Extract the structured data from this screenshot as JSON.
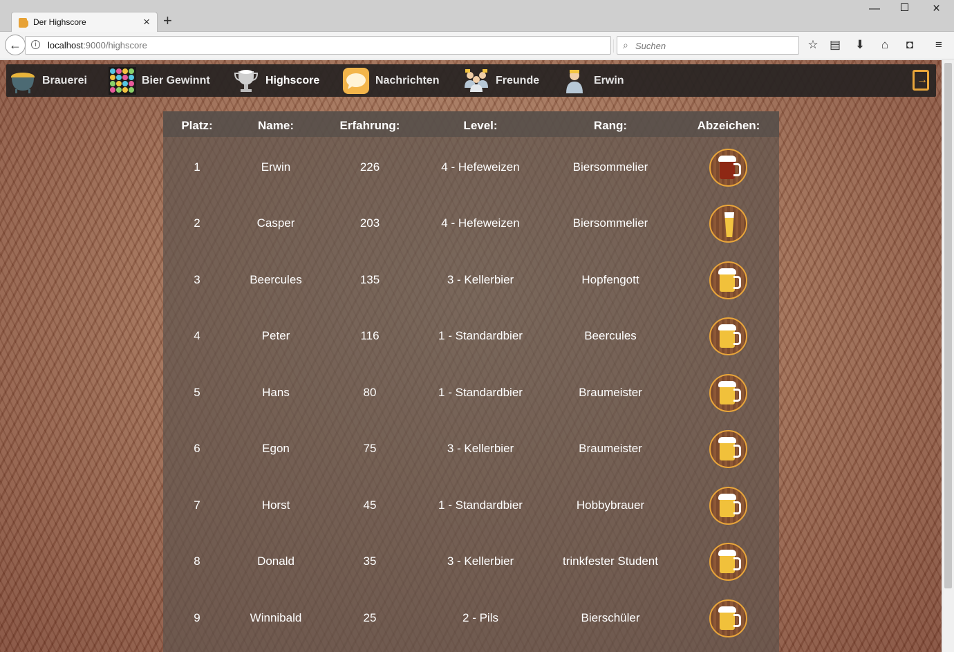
{
  "browser": {
    "tab_title": "Der Highscore",
    "url_host": "localhost",
    "url_path": ":9000/highscore",
    "search_placeholder": "Suchen"
  },
  "app_nav": {
    "items": [
      {
        "label": "Brauerei",
        "icon": "cauldron-icon"
      },
      {
        "label": "Bier Gewinnt",
        "icon": "bubble-grid-icon"
      },
      {
        "label": "Highscore",
        "icon": "trophy-icon",
        "active": true
      },
      {
        "label": "Nachrichten",
        "icon": "chat-bubble-icon"
      },
      {
        "label": "Freunde",
        "icon": "friends-icon"
      },
      {
        "label": "Erwin",
        "icon": "user-avatar-icon"
      }
    ],
    "logout_icon": "logout-icon"
  },
  "table": {
    "headers": [
      "Platz:",
      "Name:",
      "Erfahrung:",
      "Level:",
      "Rang:",
      "Abzeichen:"
    ],
    "rows": [
      {
        "platz": "1",
        "name": "Erwin",
        "erfahrung": "226",
        "level": "4 - Hefeweizen",
        "rang": "Biersommelier",
        "badge": "dark-beer-mug-icon"
      },
      {
        "platz": "2",
        "name": "Casper",
        "erfahrung": "203",
        "level": "4 - Hefeweizen",
        "rang": "Biersommelier",
        "badge": "wheat-beer-glass-icon"
      },
      {
        "platz": "3",
        "name": "Beercules",
        "erfahrung": "135",
        "level": "3 - Kellerbier",
        "rang": "Hopfengott",
        "badge": "beer-mug-icon"
      },
      {
        "platz": "4",
        "name": "Peter",
        "erfahrung": "116",
        "level": "1 - Standardbier",
        "rang": "Beercules",
        "badge": "beer-mug-icon"
      },
      {
        "platz": "5",
        "name": "Hans",
        "erfahrung": "80",
        "level": "1 - Standardbier",
        "rang": "Braumeister",
        "badge": "beer-mug-icon"
      },
      {
        "platz": "6",
        "name": "Egon",
        "erfahrung": "75",
        "level": "3 - Kellerbier",
        "rang": "Braumeister",
        "badge": "beer-mug-icon"
      },
      {
        "platz": "7",
        "name": "Horst",
        "erfahrung": "45",
        "level": "1 - Standardbier",
        "rang": "Hobbybrauer",
        "badge": "beer-mug-icon"
      },
      {
        "platz": "8",
        "name": "Donald",
        "erfahrung": "35",
        "level": "3 - Kellerbier",
        "rang": "trinkfester Student",
        "badge": "beer-mug-icon"
      },
      {
        "platz": "9",
        "name": "Winnibald",
        "erfahrung": "25",
        "level": "2 - Pils",
        "rang": "Bierschüler",
        "badge": "beer-mug-icon"
      }
    ]
  },
  "colors": {
    "nav_bg": "#282422",
    "accent": "#e8a53a",
    "beer": "#f1c13b"
  }
}
